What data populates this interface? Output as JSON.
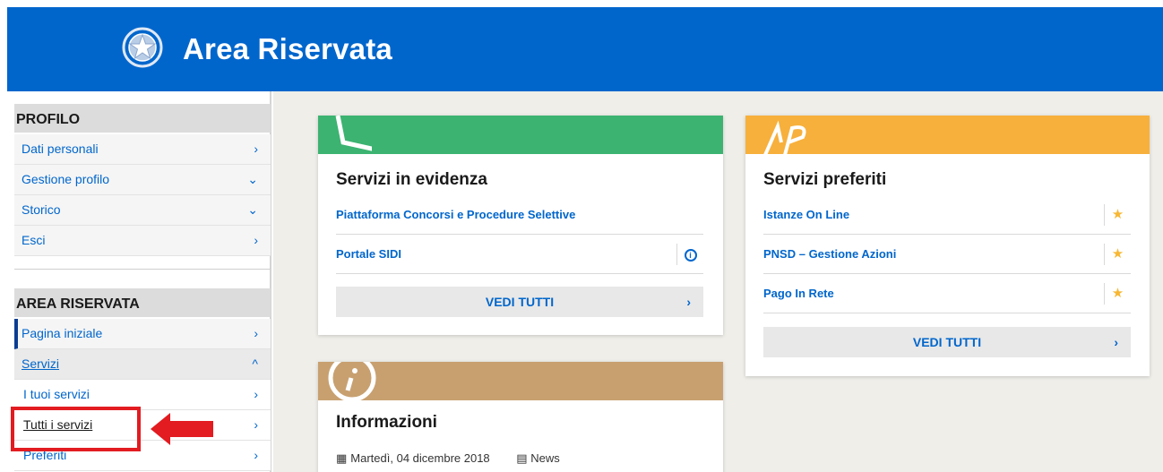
{
  "header": {
    "title": "Area Riservata",
    "emblem": "italian-republic-emblem"
  },
  "sidebar": {
    "profile_heading": "PROFILO",
    "profile_items": [
      {
        "label": "Dati personali",
        "chevron": "›"
      },
      {
        "label": "Gestione profilo",
        "chevron": "⌄"
      },
      {
        "label": "Storico",
        "chevron": "⌄"
      },
      {
        "label": "Esci",
        "chevron": "›"
      }
    ],
    "area_heading": "AREA RISERVATA",
    "area_items": [
      {
        "label": "Pagina iniziale",
        "chevron": "›"
      },
      {
        "label": "Servizi",
        "chevron": "^"
      },
      {
        "label": "I tuoi servizi",
        "chevron": "›"
      },
      {
        "label": "Tutti i servizi",
        "chevron": "›"
      },
      {
        "label": "Preferiti",
        "chevron": "›"
      }
    ]
  },
  "cards": {
    "evidenza": {
      "title": "Servizi in evidenza",
      "band_color": "#3cb371",
      "links": [
        {
          "label": "Piattaforma Concorsi e Procedure Selettive"
        },
        {
          "label": "Portale SIDI",
          "icon": "info-icon",
          "icon_text": "i"
        }
      ],
      "see_all": "VEDI TUTTI",
      "see_all_chevron": "›"
    },
    "preferiti": {
      "title": "Servizi preferiti",
      "band_color": "#f7b03c",
      "links": [
        {
          "label": "Istanze On Line",
          "star": "★"
        },
        {
          "label": "PNSD – Gestione Azioni",
          "star": "★"
        },
        {
          "label": "Pago In Rete",
          "star": "★"
        }
      ],
      "see_all": "VEDI TUTTI",
      "see_all_chevron": "›"
    },
    "informazioni": {
      "title": "Informazioni",
      "band_color": "#c8a070",
      "date": "Martedì, 04 dicembre 2018",
      "category": "News"
    }
  },
  "colors": {
    "accent": "#0066cc",
    "highlight": "#e21c21"
  }
}
